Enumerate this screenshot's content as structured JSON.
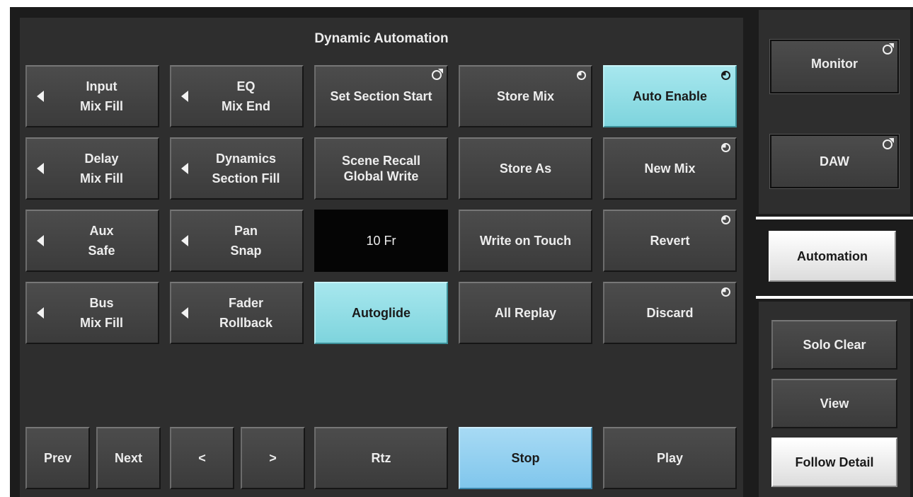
{
  "panel": {
    "title": "Dynamic Automation"
  },
  "grid": {
    "row1": {
      "input": {
        "top": "Input",
        "bottom": "Mix Fill"
      },
      "eq": {
        "top": "EQ",
        "bottom": "Mix End"
      },
      "set_section_start": "Set Section Start",
      "store_mix": "Store Mix",
      "auto_enable": "Auto Enable"
    },
    "row2": {
      "delay": {
        "top": "Delay",
        "bottom": "Mix Fill"
      },
      "dynamics": {
        "top": "Dynamics",
        "bottom": "Section Fill"
      },
      "scene_recall": {
        "top": "Scene Recall",
        "bottom": "Global Write"
      },
      "store_as": "Store As",
      "new_mix": "New Mix"
    },
    "row3": {
      "aux": {
        "top": "Aux",
        "bottom": "Safe"
      },
      "pan": {
        "top": "Pan",
        "bottom": "Snap"
      },
      "glide_time": "10 Fr",
      "write_on_touch": "Write on Touch",
      "revert": "Revert"
    },
    "row4": {
      "bus": {
        "top": "Bus",
        "bottom": "Mix Fill"
      },
      "fader": {
        "top": "Fader",
        "bottom": "Rollback"
      },
      "autoglide": "Autoglide",
      "all_replay": "All Replay",
      "discard": "Discard"
    }
  },
  "transport": {
    "prev": "Prev",
    "next": "Next",
    "back": "<",
    "forward": ">",
    "rtz": "Rtz",
    "stop": "Stop",
    "play": "Play"
  },
  "sidebar": {
    "monitor": "Monitor",
    "daw": "DAW",
    "automation": "Automation",
    "solo_clear": "Solo Clear",
    "view": "View",
    "follow_detail": "Follow Detail"
  },
  "colors": {
    "active_cyan": "#8fdce4",
    "active_blue": "#90cef0",
    "button_gray": "#444444",
    "panel": "#2e2e2e",
    "display": "#050505"
  },
  "icons": {
    "section_icon": "pie-quarter-icon",
    "external_icon": "circle-arrow-icon",
    "left_arrow": "triangle-left-icon"
  }
}
